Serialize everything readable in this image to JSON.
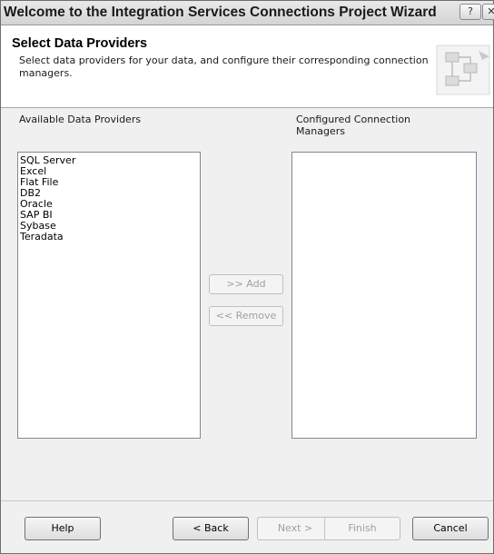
{
  "window": {
    "title": "Welcome to the Integration Services Connections Project Wizard",
    "help_glyph": "?",
    "close_glyph": "✕"
  },
  "header": {
    "title": "Select Data Providers",
    "description": "Select data providers for your data, and configure their corresponding connection managers.",
    "graphic_icon": "wizard-flowchart-icon"
  },
  "available": {
    "label": "Available Data Providers",
    "items": [
      "SQL Server",
      "Excel",
      "Flat File",
      "DB2",
      "Oracle",
      "SAP BI",
      "Sybase",
      "Teradata"
    ]
  },
  "configured": {
    "label": "Configured Connection Managers",
    "items": []
  },
  "actions": {
    "add_label": ">> Add",
    "remove_label": "<< Remove"
  },
  "footer": {
    "help_label": "Help",
    "back_label": "< Back",
    "next_label": "Next >",
    "finish_label": "Finish",
    "cancel_label": "Cancel"
  }
}
